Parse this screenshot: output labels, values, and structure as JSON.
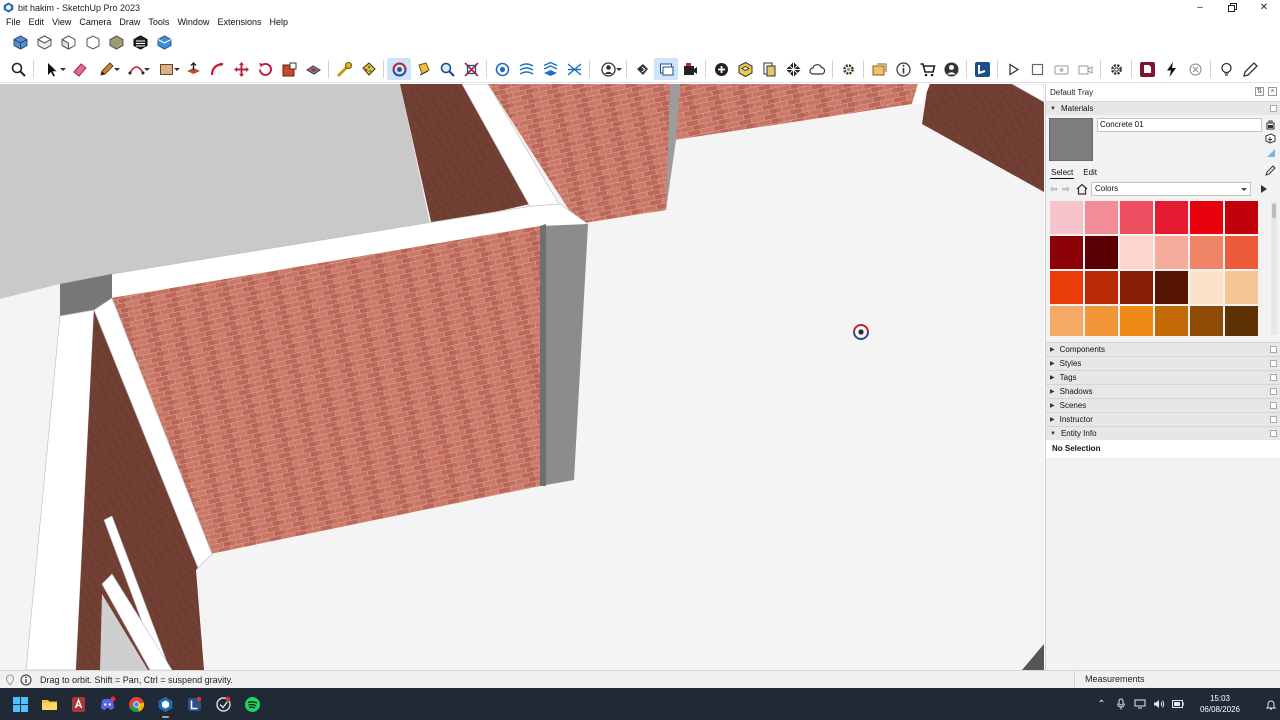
{
  "window": {
    "title": "bit hakim - SketchUp Pro 2023",
    "controls": [
      "minimize-icon",
      "restore-icon",
      "close-icon"
    ]
  },
  "menu": [
    "File",
    "Edit",
    "View",
    "Camera",
    "Draw",
    "Tools",
    "Window",
    "Extensions",
    "Help"
  ],
  "toolbar_views": [
    "iso-view-icon",
    "top-view-icon",
    "front-view-icon",
    "right-view-icon",
    "back-view-icon",
    "left-view-icon",
    "bottom-view-icon"
  ],
  "toolbar_main": {
    "icons": [
      "zoom-extents-icon",
      "select-icon",
      "eraser-icon",
      "pencil-line-icon",
      "arc-icon",
      "rectangle-icon",
      "push-pull-icon",
      "follow-me-icon",
      "move-icon",
      "rotate-icon",
      "scale-icon",
      "offset-icon",
      "tape-measure-icon",
      "paint-bucket-icon",
      "orbit-icon",
      "walk-icon",
      "zoom-icon",
      "zoom-window-icon",
      "section-plane-icon",
      "sandbox-icon",
      "contours-icon",
      "drape-icon",
      "account-icon",
      "style-builder-icon",
      "outliner-icon",
      "camera-icon",
      "add-location-icon",
      "solid-tools-icon",
      "layout-icon",
      "checker-icon",
      "cloud-icon",
      "settings-icon",
      "export-icon",
      "info-icon",
      "warehouse-icon",
      "profile-icon",
      "sketchup-logo-icon",
      "play-icon",
      "stop-icon",
      "record-icon",
      "movie-icon",
      "gear-icon",
      "extension-icon",
      "lightning-icon",
      "cancel-icon",
      "bulb-icon",
      "pen-icon"
    ],
    "active": "orbit-icon"
  },
  "tray": {
    "title": "Default Tray",
    "materials": {
      "header": "Materials",
      "current_name": "Concrete 01",
      "preview_color": "#7d7d7d",
      "tabs": [
        "Select",
        "Edit"
      ],
      "selected_tab": "Select",
      "collection": "Colors",
      "swatches": [
        "#f8c4cb",
        "#f28c96",
        "#ec4d5f",
        "#e31a32",
        "#e8000d",
        "#c0000a",
        "#8c0008",
        "#5a0004",
        "#fbd6cd",
        "#f5ac9a",
        "#f08467",
        "#eb5b3a",
        "#eb3d0c",
        "#b82b06",
        "#861f05",
        "#551402",
        "#fbe2c9",
        "#f7c696",
        "#f4a964",
        "#f19738",
        "#f08a16",
        "#c36a07",
        "#8e4c05",
        "#5d3103"
      ]
    },
    "panels": [
      "Components",
      "Styles",
      "Tags",
      "Shadows",
      "Scenes",
      "Instructor"
    ],
    "entity_info": {
      "header": "Entity Info",
      "status": "No Selection"
    }
  },
  "statusbar": {
    "message": "Drag to orbit. Shift = Pan, Ctrl = suspend gravity.",
    "measurements_label": "Measurements"
  },
  "taskbar": {
    "apps": [
      "windows-start-icon",
      "file-explorer-icon",
      "access-icon",
      "discord-icon",
      "chrome-icon",
      "sketchup-icon",
      "layout-app-icon",
      "style-builder-app-icon",
      "spotify-icon"
    ],
    "running": [
      "sketchup-icon"
    ],
    "time": "15:03",
    "date": "06/08/2026"
  },
  "colors": {
    "brick": "#c0705f",
    "brick_dark": "#6b3a2e",
    "wall_gray": "#8a8a8a",
    "ground": "#f4f4f4",
    "wall_top": "#ffffff"
  }
}
